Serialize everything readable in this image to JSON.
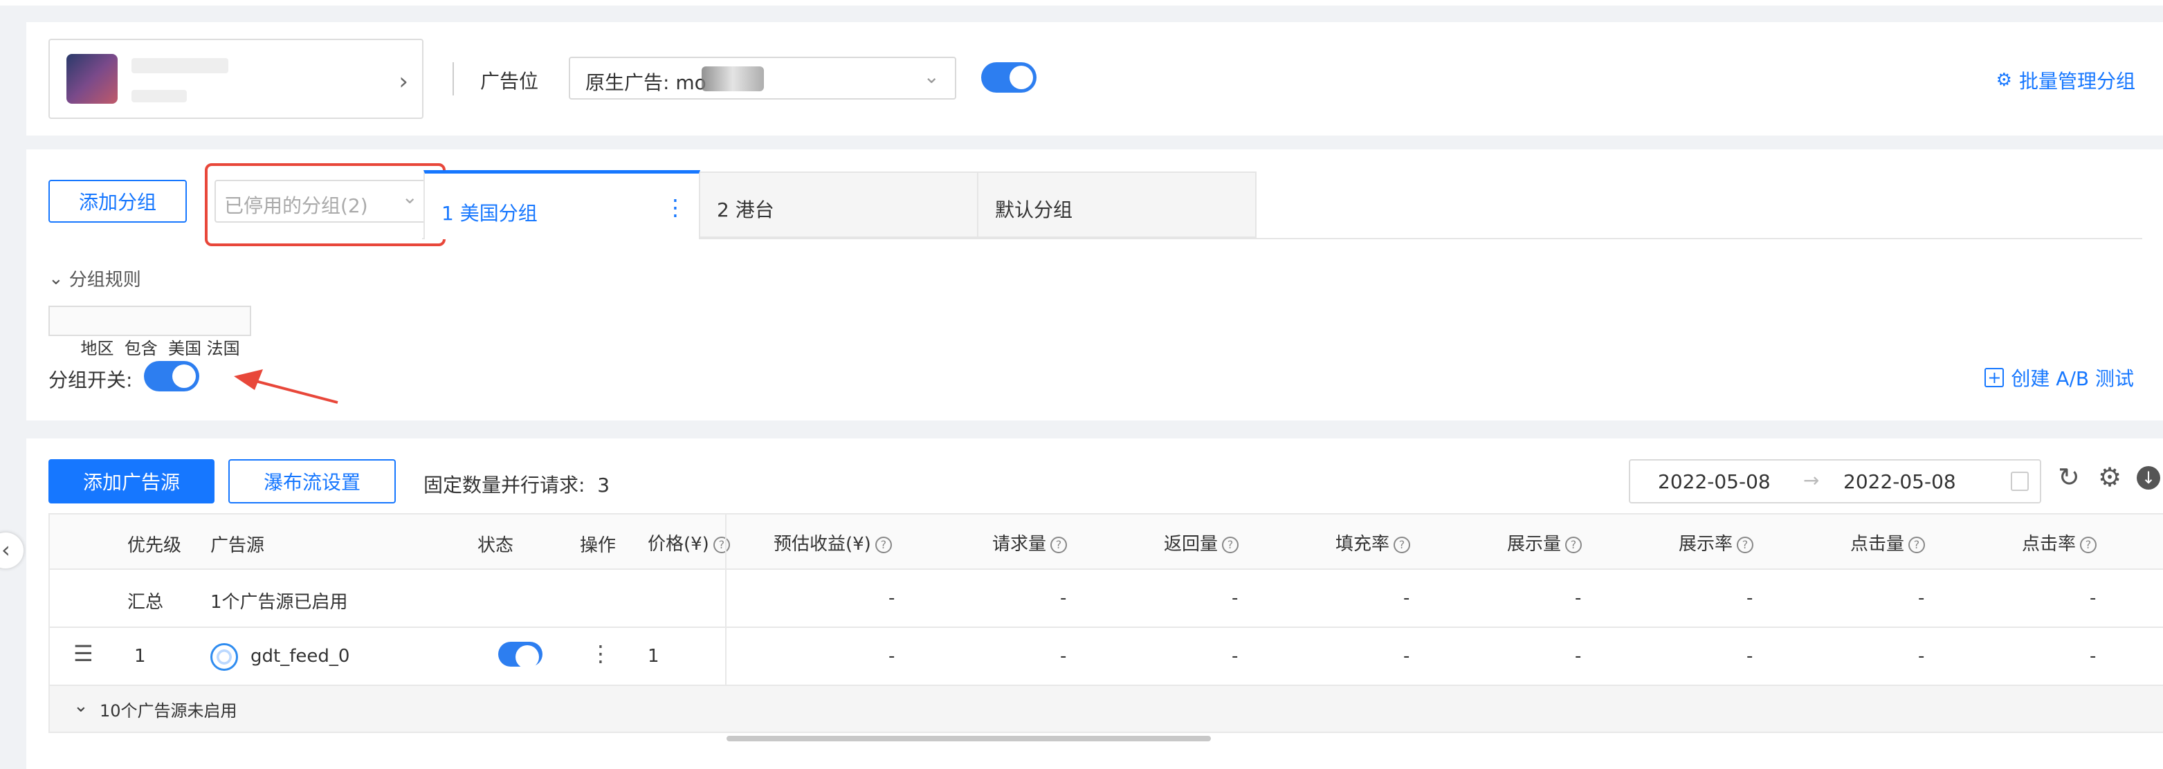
{
  "header": {
    "app_name_placeholder": "",
    "ad_slot_label": "广告位",
    "ad_slot_value": "原生广告: mo",
    "batch_manage": "批量管理分组"
  },
  "groups": {
    "add_group": "添加分组",
    "disabled_groups": "已停用的分组(2)",
    "tabs": [
      {
        "label": "1 美国分组"
      },
      {
        "label": "2 港台"
      },
      {
        "label": "默认分组"
      }
    ],
    "rules_toggle": "分组规则",
    "rule_tag": "地区  包含  美国 法国",
    "switch_label": "分组开关:",
    "create_ab": "创建 A/B 测试"
  },
  "sources": {
    "add_source": "添加广告源",
    "waterfall": "瀑布流设置",
    "parallel_label": "固定数量并行请求:  3",
    "date_start": "2022-05-08",
    "date_end": "2022-05-08",
    "columns": {
      "priority": "优先级",
      "source": "广告源",
      "status": "状态",
      "action": "操作",
      "price": "价格(¥)",
      "revenue": "预估收益(¥)",
      "requests": "请求量",
      "returns": "返回量",
      "fill_rate": "填充率",
      "impressions": "展示量",
      "show_rate": "展示率",
      "clicks": "点击量",
      "ctr": "点击率"
    },
    "summary": {
      "label": "汇总",
      "enabled": "1个广告源已启用"
    },
    "rows": [
      {
        "priority": "1",
        "name": "gdt_feed_0",
        "price": "1"
      }
    ],
    "metric_placeholder": "-",
    "disabled_toggle": "10个广告源未启用"
  },
  "colors": {
    "accent": "#1677ff",
    "highlight_box": "#e8473a"
  }
}
